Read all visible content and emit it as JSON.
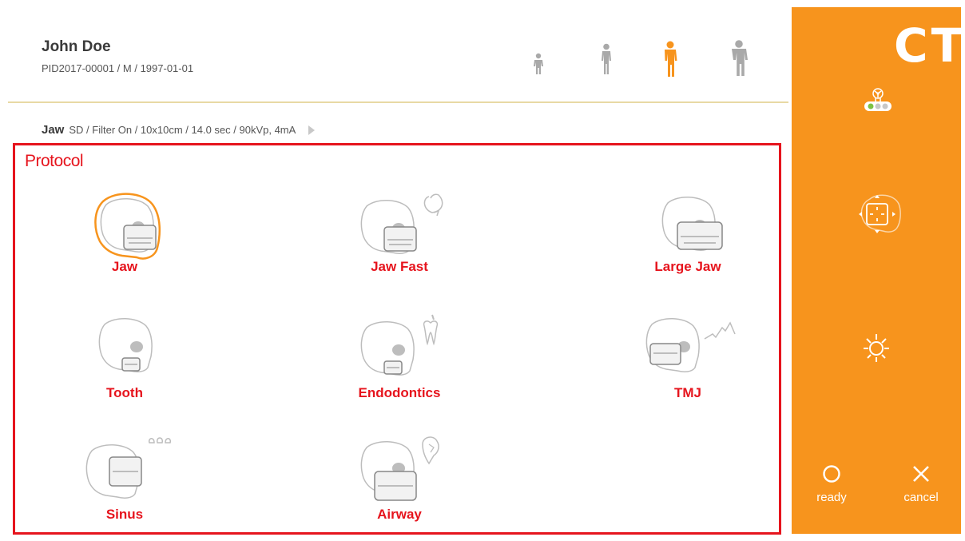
{
  "patient": {
    "name": "John Doe",
    "meta": "PID2017-00001 / M / 1997-01-01"
  },
  "body_sizes": {
    "items": [
      "child-small",
      "child",
      "adult-selected",
      "adult-large"
    ],
    "selected_color": "#f7941d",
    "default_color": "#a9a9a9"
  },
  "summary": {
    "protocol": "Jaw",
    "details": "SD / Filter On / 10x10cm / 14.0 sec / 90kVp, 4mA"
  },
  "protocol": {
    "heading": "Protocol",
    "items": [
      {
        "label": "Jaw",
        "selected": true
      },
      {
        "label": "Jaw Fast",
        "selected": false
      },
      {
        "label": "Large Jaw",
        "selected": false
      },
      {
        "label": "Tooth",
        "selected": false
      },
      {
        "label": "Endodontics",
        "selected": false
      },
      {
        "label": "TMJ",
        "selected": false
      },
      {
        "label": "Sinus",
        "selected": false
      },
      {
        "label": "Airway",
        "selected": false
      }
    ]
  },
  "sidebar": {
    "title": "CT",
    "accent_color": "#f7941d",
    "ready_label": "ready",
    "cancel_label": "cancel",
    "icons": [
      "xray-status-icon",
      "positioning-icon",
      "light-icon"
    ]
  }
}
